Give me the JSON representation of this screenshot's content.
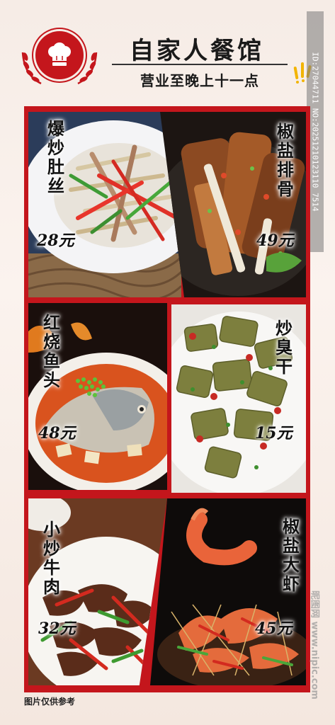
{
  "header": {
    "title": "自家人餐馆",
    "subtitle": "营业至晚上十一点"
  },
  "watermark": {
    "id_text": "ID:27044711 NO:20251210123110 7514",
    "brand_text": "昵图网 www.nipic.com"
  },
  "dishes": [
    {
      "name": "爆炒肚丝",
      "price": "28元"
    },
    {
      "name": "椒盐排骨",
      "price": "49元"
    },
    {
      "name": "红烧鱼头",
      "price": "48元"
    },
    {
      "name": "炒臭干",
      "price": "15元"
    },
    {
      "name": "小炒牛肉",
      "price": "32元"
    },
    {
      "name": "椒盐大虾",
      "price": "45元"
    }
  ],
  "footer": {
    "note": "图片仅供参考"
  },
  "colors": {
    "brand_red": "#c4161c",
    "background": "#f6ece6"
  }
}
